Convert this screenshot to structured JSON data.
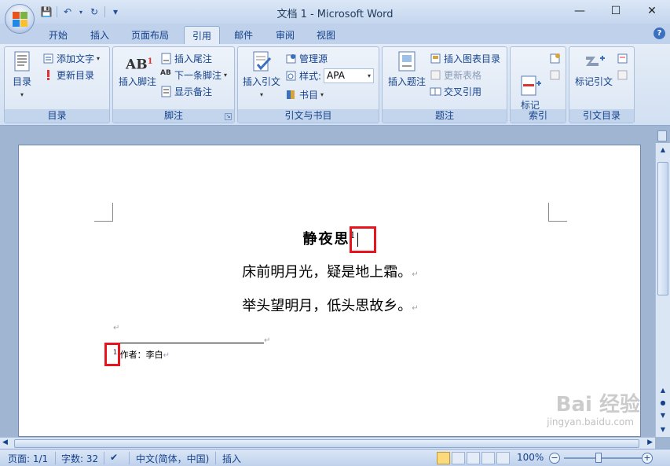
{
  "window": {
    "title": "文档 1 - Microsoft Word",
    "minimize": "—",
    "maximize": "☐",
    "close": "✕"
  },
  "qat": {
    "save": "💾",
    "undo": "↶",
    "redo": "↻",
    "more": "▾"
  },
  "tabs": [
    {
      "label": "开始",
      "active": false
    },
    {
      "label": "插入",
      "active": false
    },
    {
      "label": "页面布局",
      "active": false
    },
    {
      "label": "引用",
      "active": true
    },
    {
      "label": "邮件",
      "active": false
    },
    {
      "label": "审阅",
      "active": false
    },
    {
      "label": "视图",
      "active": false
    }
  ],
  "help_icon": "?",
  "ribbon": {
    "toc": {
      "label": "目录",
      "toc_button": "目录",
      "add_text": "添加文字",
      "update_table": "更新目录"
    },
    "footnotes": {
      "label": "脚注",
      "insert_footnote": "插入脚注",
      "ab_icon_text": "AB",
      "ab_icon_sup": "1",
      "insert_endnote": "插入尾注",
      "next_footnote": "下一条脚注",
      "show_notes": "显示备注"
    },
    "citations": {
      "label": "引文与书目",
      "insert_citation": "插入引文",
      "manage_sources": "管理源",
      "style_label": "样式:",
      "style_value": "APA",
      "bibliography": "书目"
    },
    "captions": {
      "label": "题注",
      "insert_caption": "插入题注",
      "insert_table_of_figures": "插入图表目录",
      "update_table": "更新表格",
      "cross_reference": "交叉引用"
    },
    "index": {
      "label": "索引",
      "mark_entry": "标记\n索引项"
    },
    "table_of_authorities": {
      "label": "引文目录",
      "mark_citation": "标记引文"
    }
  },
  "document": {
    "title": "静夜思",
    "footnote_ref": "1",
    "line1": "床前明月光，疑是地上霜。",
    "line2": "举头望明月，低头思故乡。",
    "para_mark": "↵",
    "footnote_num": "1",
    "footnote_text": "作者：李白"
  },
  "statusbar": {
    "page": "页面: 1/1",
    "words": "字数: 32",
    "language": "中文(简体，中国)",
    "mode": "插入",
    "zoom": "100%",
    "zoom_minus": "−",
    "zoom_plus": "+"
  },
  "watermark": {
    "brand": "Bai 经验",
    "url": "jingyan.baidu.com"
  },
  "colors": {
    "highlight": "#e8141e",
    "accent": "#15428b"
  }
}
